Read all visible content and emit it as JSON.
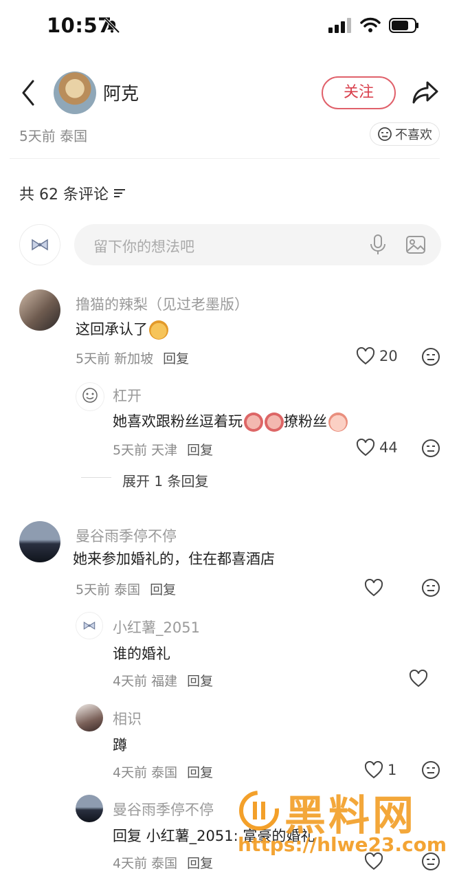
{
  "status_bar": {
    "time": "10:57"
  },
  "post": {
    "author": "阿克",
    "follow_label": "关注",
    "meta": "5天前 泰国",
    "dislike_label": "不喜欢"
  },
  "comments_header": {
    "count_label": "共 62 条评论"
  },
  "input": {
    "placeholder": "留下你的想法吧"
  },
  "comments": [
    {
      "user": "撸猫的辣梨（见过老墨版）",
      "text": "这回承认了",
      "time": "5天前 新加坡",
      "reply_label": "回复",
      "likes": "20",
      "replies": [
        {
          "user": "杠开",
          "text_parts": [
            "她喜欢跟粉丝逗着玩",
            "撩粉丝"
          ],
          "time": "5天前 天津",
          "reply_label": "回复",
          "likes": "44"
        }
      ],
      "expand_label": "展开 1 条回复"
    },
    {
      "user": "曼谷雨季停不停",
      "text": "她来参加婚礼的，住在都喜酒店",
      "time": "5天前 泰国",
      "reply_label": "回复",
      "likes": "",
      "replies": [
        {
          "user": "小红薯_2051",
          "text": "谁的婚礼",
          "time": "4天前 福建",
          "reply_label": "回复",
          "likes": ""
        },
        {
          "user": "相识",
          "text": "蹲",
          "time": "4天前 泰国",
          "reply_label": "回复",
          "likes": "1"
        },
        {
          "user": "曼谷雨季停不停",
          "text": "回复 小红薯_2051: 富豪的婚礼",
          "time": "4天前 泰国",
          "reply_label": "回复",
          "likes": ""
        }
      ]
    }
  ],
  "watermark": {
    "title": "黑料网",
    "url": "https://hlwe23.com"
  },
  "colors": {
    "accent": "#d9404d",
    "watermark": "#f3a02a"
  }
}
